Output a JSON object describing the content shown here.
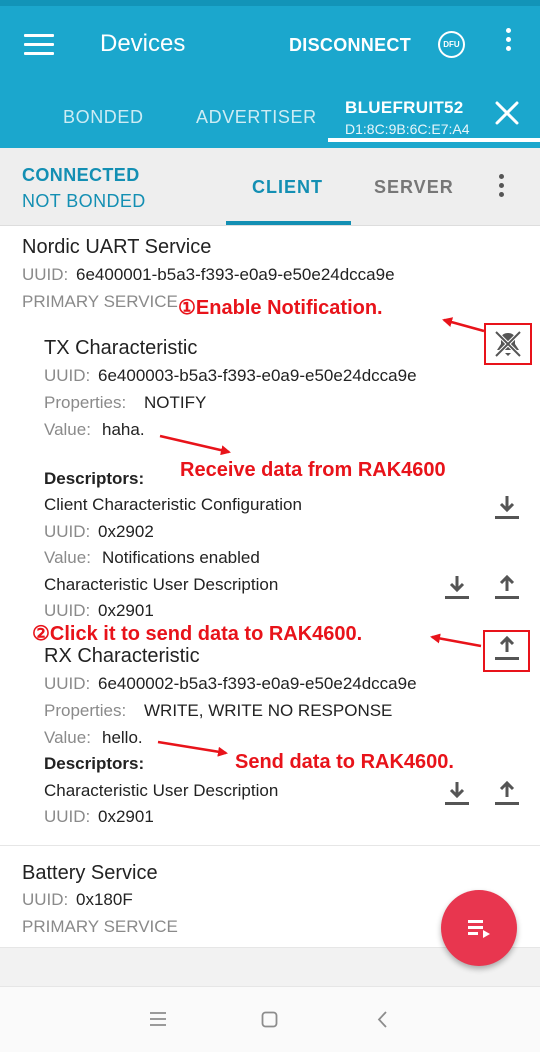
{
  "appbar": {
    "title": "Devices",
    "disconnect_label": "DISCONNECT",
    "dfu_label": "DFU",
    "icons": [
      "menu-icon",
      "dfu-icon",
      "more-vert-icon"
    ],
    "tabs": [
      {
        "label": "BONDED"
      },
      {
        "label": "ADVERTISER"
      },
      {
        "label": "BLUEFRUIT52",
        "sublabel": "D1:8C:9B:6C:E7:A4",
        "selected": true
      }
    ],
    "background_color": "#1ba7cd"
  },
  "connection": {
    "status": "CONNECTED",
    "bond_status": "NOT BONDED",
    "tabs": [
      {
        "label": "CLIENT",
        "selected": true
      },
      {
        "label": "SERVER"
      }
    ]
  },
  "services": [
    {
      "name": "Nordic UART Service",
      "uuid_label": "UUID:",
      "uuid": "6e400001-b5a3-f393-e0a9-e50e24dcca9e",
      "type": "PRIMARY SERVICE",
      "characteristics": [
        {
          "name": "TX Characteristic",
          "uuid_label": "UUID:",
          "uuid": "6e400003-b5a3-f393-e0a9-e50e24dcca9e",
          "properties_label": "Properties:",
          "properties": "NOTIFY",
          "value_label": "Value:",
          "value": "haha.",
          "descriptors_label": "Descriptors:",
          "descriptors": [
            {
              "name": "Client Characteristic Configuration",
              "uuid_label": "UUID:",
              "uuid": "0x2902",
              "value_label": "Value:",
              "value": "Notifications enabled"
            },
            {
              "name": "Characteristic User Description",
              "uuid_label": "UUID:",
              "uuid": "0x2901"
            }
          ]
        },
        {
          "name": "RX Characteristic",
          "uuid_label": "UUID:",
          "uuid": "6e400002-b5a3-f393-e0a9-e50e24dcca9e",
          "properties_label": "Properties:",
          "properties": "WRITE, WRITE NO RESPONSE",
          "value_label": "Value:",
          "value": "hello.",
          "descriptors_label": "Descriptors:",
          "descriptors": [
            {
              "name": "Characteristic User Description",
              "uuid_label": "UUID:",
              "uuid": "0x2901"
            }
          ]
        }
      ]
    },
    {
      "name": "Battery Service",
      "uuid_label": "UUID:",
      "uuid": "0x180F",
      "type": "PRIMARY SERVICE"
    }
  ],
  "annotations": {
    "enable_notification": "①Enable Notification.",
    "receive": "Receive data from RAK4600",
    "click_send": "②Click it to send data to RAK4600.",
    "send": "Send data to RAK4600.",
    "color": "#e8131a"
  },
  "fab": {
    "icon": "log-list-icon",
    "color": "#e8364f"
  },
  "navbar": {
    "icons": [
      "recents-icon",
      "home-icon",
      "back-icon"
    ]
  }
}
